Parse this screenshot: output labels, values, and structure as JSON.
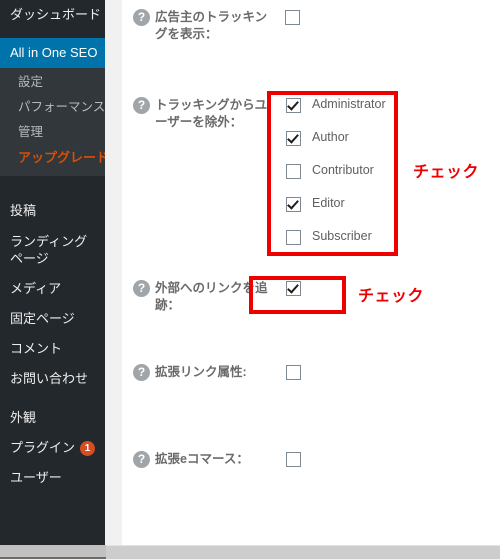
{
  "sidebar": {
    "items": [
      {
        "label": "ダッシュボード",
        "type": "top"
      },
      {
        "label": "All in One SEO",
        "type": "current"
      }
    ],
    "submenu": [
      {
        "label": "設定",
        "style": "normal"
      },
      {
        "label": "パフォーマンス",
        "style": "normal"
      },
      {
        "label": "管理",
        "style": "normal"
      },
      {
        "label": "アップグレード",
        "style": "upgrade"
      }
    ],
    "lower_items": [
      {
        "label": "投稿",
        "badge": ""
      },
      {
        "label": "ランディングページ",
        "badge": ""
      },
      {
        "label": "メディア",
        "badge": ""
      },
      {
        "label": "固定ページ",
        "badge": ""
      },
      {
        "label": "コメント",
        "badge": ""
      },
      {
        "label": "お問い合わせ",
        "badge": ""
      },
      {
        "label": "外観",
        "badge": ""
      },
      {
        "label": "プラグイン",
        "badge": "1"
      },
      {
        "label": "ユーザー",
        "badge": ""
      }
    ]
  },
  "settings": {
    "rows": [
      {
        "label": "広告主のトラッキングを表示：",
        "help_icon": "question-icon",
        "checked": false
      },
      {
        "label": "トラッキングからユーザーを除外：",
        "help_icon": "question-icon"
      },
      {
        "label": "外部へのリンクを追跡：",
        "help_icon": "question-icon",
        "checked": true
      },
      {
        "label": "拡張リンク属性:",
        "help_icon": "question-icon",
        "checked": false
      },
      {
        "label": "拡張eコマース：",
        "help_icon": "question-icon",
        "checked": false
      }
    ],
    "roles": [
      {
        "label": "Administrator",
        "checked": true
      },
      {
        "label": "Author",
        "checked": true
      },
      {
        "label": "Contributor",
        "checked": false
      },
      {
        "label": "Editor",
        "checked": true
      },
      {
        "label": "Subscriber",
        "checked": false
      }
    ]
  },
  "annotations": [
    {
      "text": "チェック",
      "target": "role-list"
    },
    {
      "text": "チェック",
      "target": "track-outbound-links"
    }
  ],
  "colors": {
    "sidebar_bg": "#23282d",
    "submenu_bg": "#32373c",
    "active_blue": "#0073aa",
    "upgrade_orange": "#d64e07",
    "badge_orange": "#d54e21",
    "annotation_red": "#ef0000"
  },
  "icons": {
    "help": "?",
    "checkmark": "✔"
  }
}
